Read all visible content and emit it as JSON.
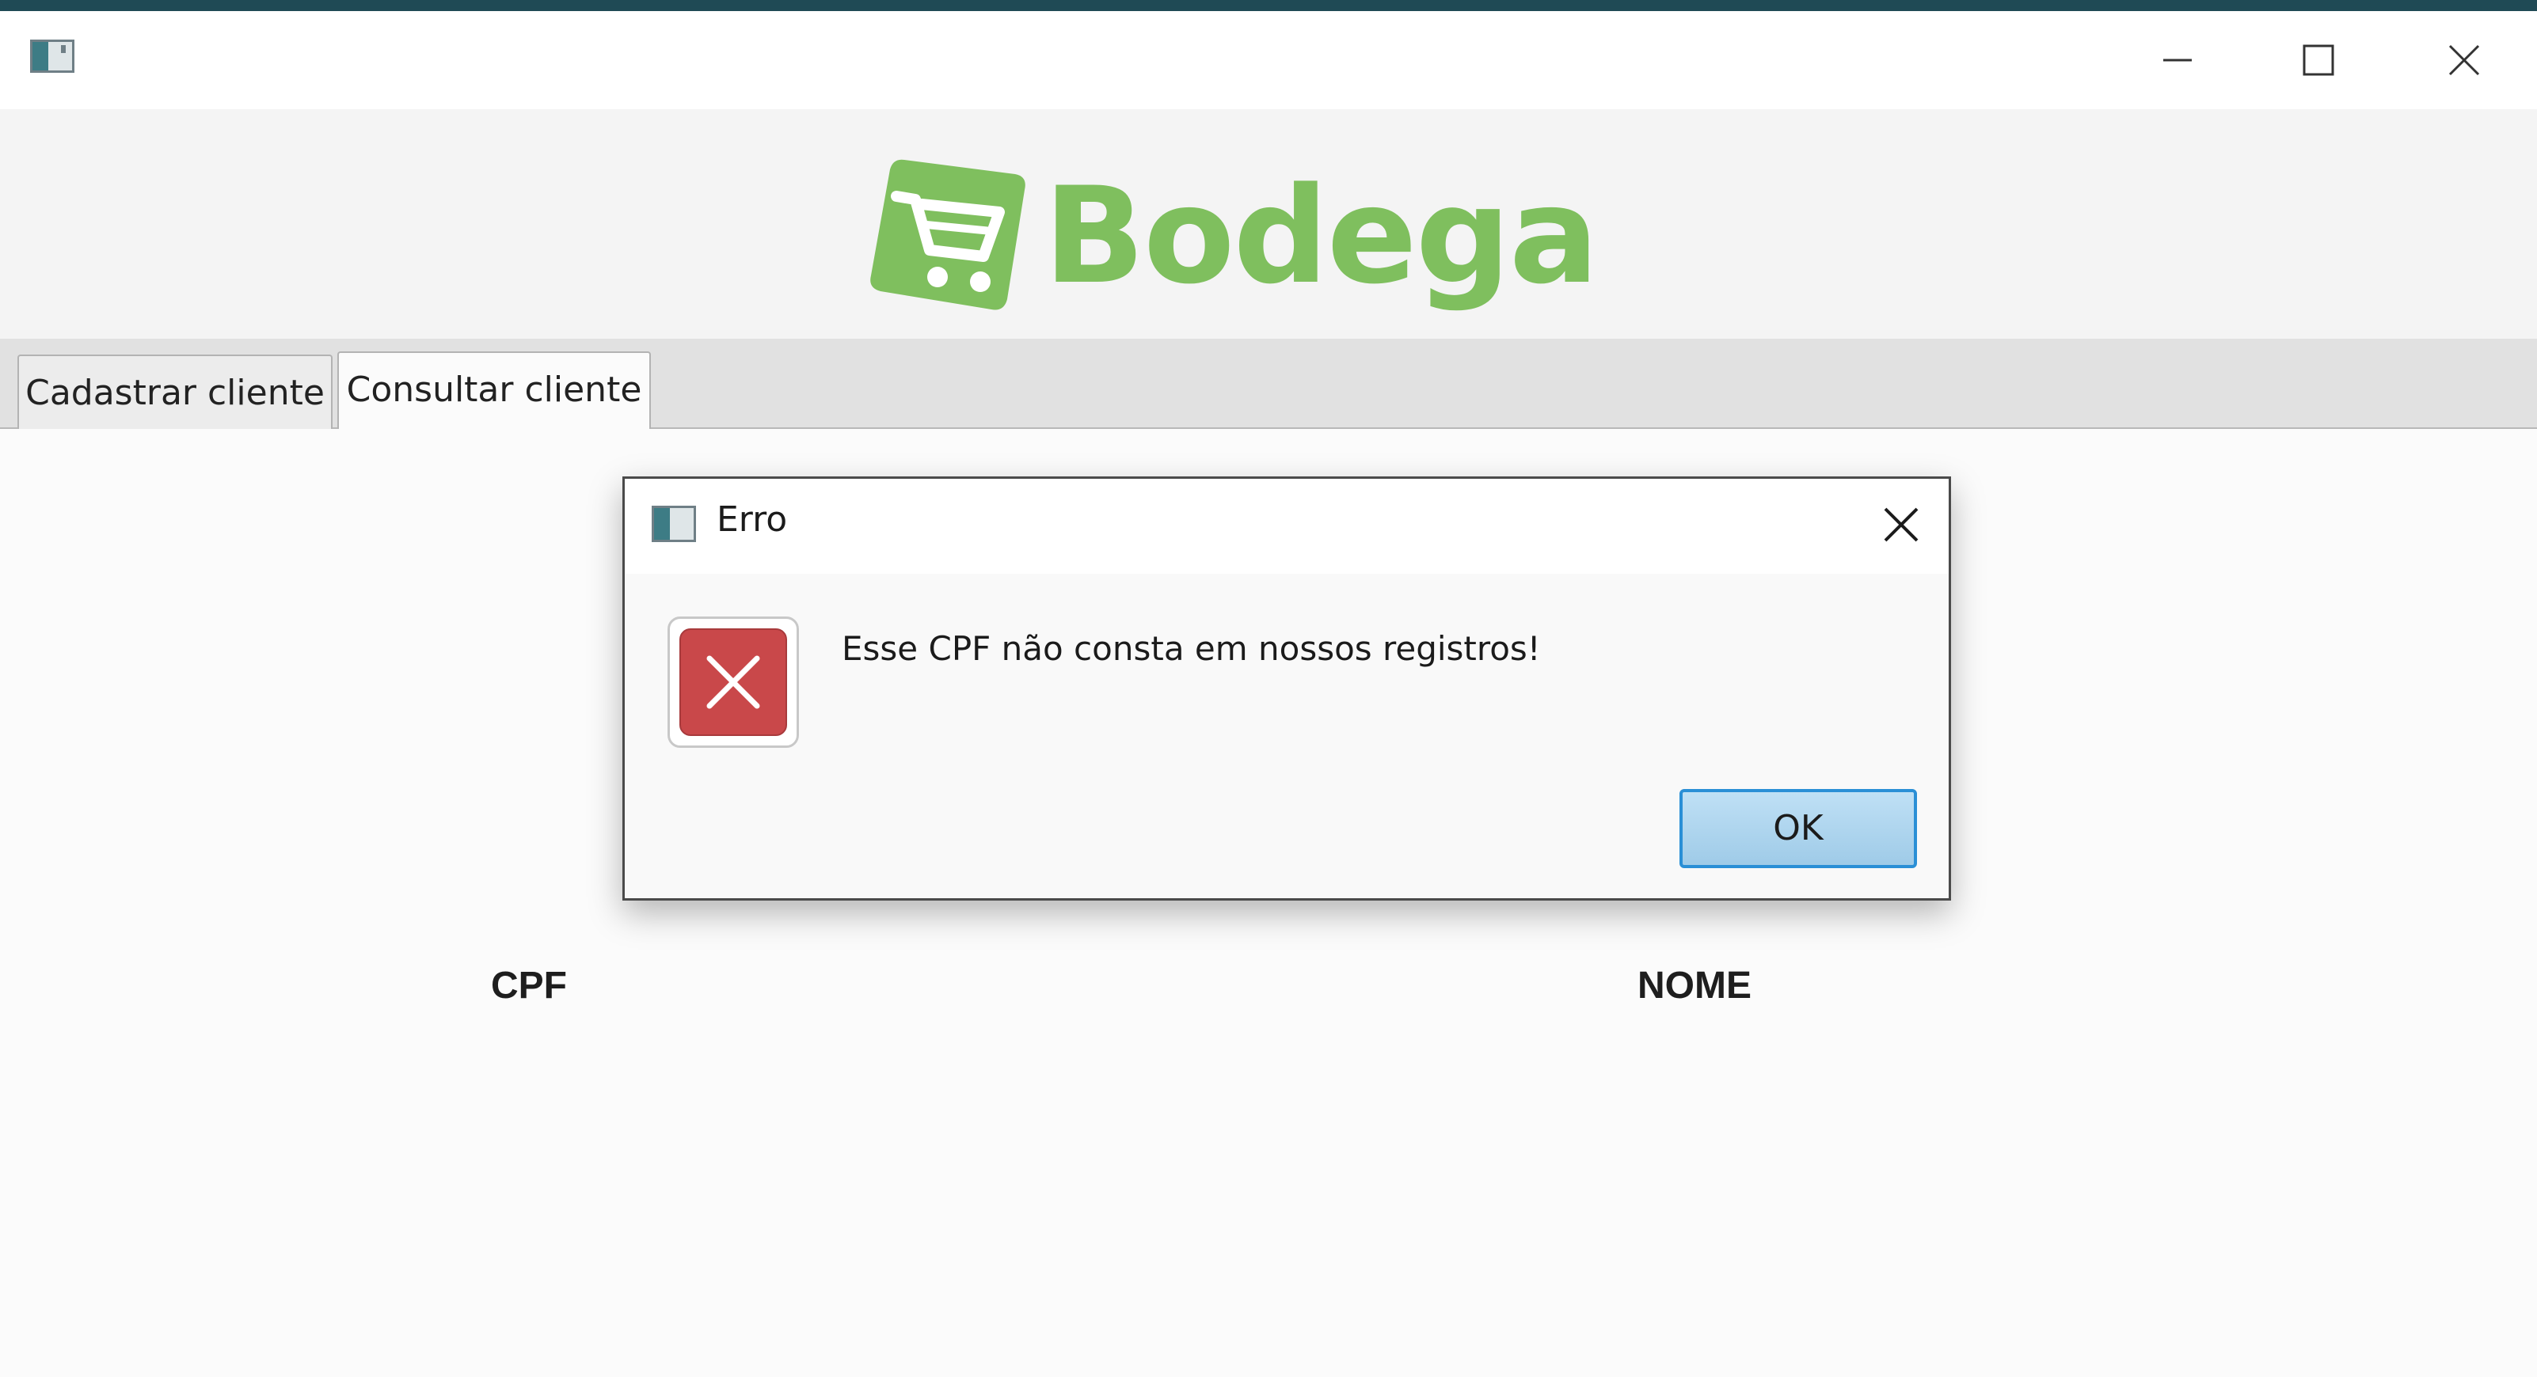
{
  "window": {
    "icon": "app-window-icon",
    "controls": [
      "minimize-icon",
      "maximize-icon",
      "close-icon"
    ]
  },
  "header": {
    "logo_icon": "shopping-cart-icon",
    "logo_text": "Bodega",
    "brand_color": "#7fbf5e"
  },
  "tabs": [
    {
      "label": "Cadastrar cliente",
      "selected": false
    },
    {
      "label": "Consultar cliente",
      "selected": true
    }
  ],
  "table": {
    "columns": [
      "CPF",
      "NOME"
    ]
  },
  "dialog": {
    "title": "Erro",
    "icon": "error-x-icon",
    "message": "Esse CPF não consta em nossos registros!",
    "ok_label": "OK",
    "error_color": "#c9484a",
    "accent_color": "#2a8fd6"
  }
}
